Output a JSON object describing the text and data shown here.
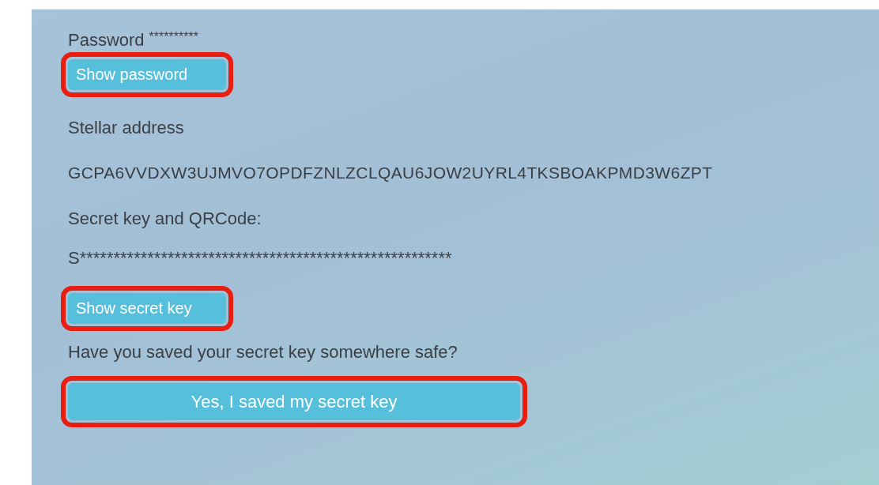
{
  "password": {
    "label": "Password",
    "value": "**********"
  },
  "show_password_button": {
    "label": "Show password",
    "highlighted": true
  },
  "address": {
    "label": "Stellar address",
    "value": "GCPA6VVDXW3UJMVO7OPDFZNLZCLQAU6JOW2UYRL4TKSBOAKPMD3W6ZPT"
  },
  "secret": {
    "label": "Secret key and QRCode:",
    "value": "S*******************************************************"
  },
  "show_secret_button": {
    "label": "Show secret key",
    "highlighted": true
  },
  "question": "Have you saved your secret key somewhere safe?",
  "confirm_button": {
    "label": "Yes, I saved my secret key",
    "highlighted": true
  }
}
